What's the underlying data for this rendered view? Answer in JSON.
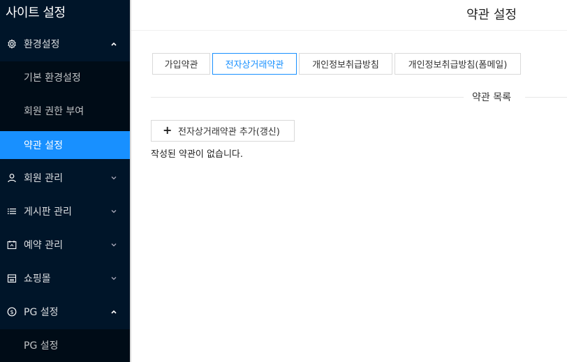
{
  "sidebar": {
    "title": "사이트 설정",
    "groups": [
      {
        "label": "환경설정",
        "icon": "gear-icon",
        "expanded": true
      },
      {
        "label": "회원 관리",
        "icon": "user-icon",
        "expanded": false
      },
      {
        "label": "게시판 관리",
        "icon": "list-icon",
        "expanded": false
      },
      {
        "label": "예약 관리",
        "icon": "calendar-icon",
        "expanded": false
      },
      {
        "label": "쇼핑몰",
        "icon": "shop-icon",
        "expanded": false
      },
      {
        "label": "PG 설정",
        "icon": "dollar-circle-icon",
        "expanded": true
      }
    ],
    "env_items": [
      {
        "label": "기본 환경설정",
        "active": false
      },
      {
        "label": "회원 권한 부여",
        "active": false
      },
      {
        "label": "약관 설정",
        "active": true
      }
    ],
    "pg_items": [
      {
        "label": "PG 설정"
      }
    ],
    "active_color": "#1890ff",
    "bg_color": "#001529"
  },
  "header": {
    "title": "약관 설정"
  },
  "tabs": [
    {
      "label": "가입약관",
      "active": false
    },
    {
      "label": "전자상거래약관",
      "active": true
    },
    {
      "label": "개인정보취급방침",
      "active": false
    },
    {
      "label": "개인정보취급방침(폼메일)",
      "active": false
    }
  ],
  "section": {
    "divider_label": "약관 목록",
    "add_button_label": "전자상거래약관 추가(갱신)",
    "empty_message": "작성된 약관이 없습니다."
  }
}
